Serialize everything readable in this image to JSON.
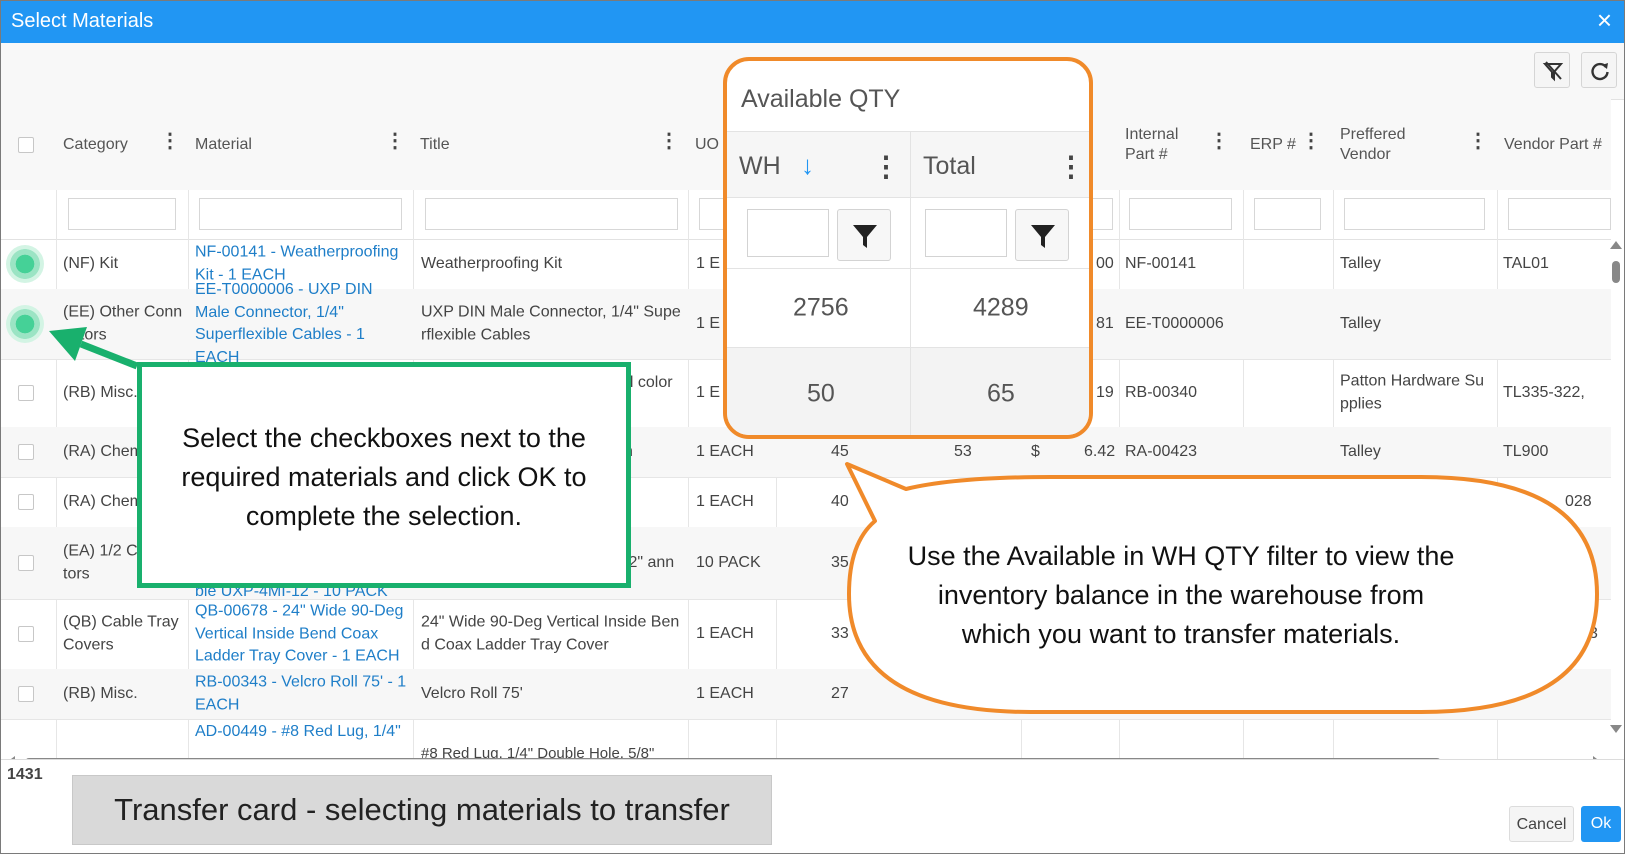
{
  "window": {
    "title": "Select Materials",
    "close_glyph": "×"
  },
  "toolbar": {
    "icons": [
      "filter-clear-icon",
      "refresh-icon"
    ]
  },
  "columns": {
    "category": "Category",
    "material": "Material",
    "title": "Title",
    "uom": "UO",
    "internal_part": "Internal Part #",
    "erp": "ERP #",
    "preferred_vendor": "Preffered Vendor",
    "vendor_part": "Vendor Part #"
  },
  "rows": [
    {
      "category": "(NF) Kit",
      "material": "NF-00141 - Weatherproofing Kit - 1 EACH",
      "title": "Weatherproofing Kit",
      "uom": "1 E",
      "cost_tail": "00",
      "internal": "NF-00141",
      "vendor": "Talley",
      "vendor_part": "TAL01"
    },
    {
      "category": "(EE) Other Connectors",
      "material": "EE-T0000006 - UXP DIN Male Connector, 1/4\" Superflexible Cables - 1 EACH",
      "title": "UXP DIN Male Connector, 1/4\" Superflexible Cables",
      "uom": "1 E",
      "cost_tail": "81",
      "internal": "EE-T0000006",
      "vendor": "Talley",
      "vendor_part": ""
    },
    {
      "category": "(RB) Misc.",
      "material": "",
      "title": "al color",
      "uom": "1 E",
      "cost_tail": "19",
      "internal": "RB-00340",
      "vendor": "Patton Hardware Supplies",
      "vendor_part": "TL335-322,"
    },
    {
      "category": "(RA) Chem",
      "material": "",
      "title": "n",
      "uom": "1 EACH",
      "wh": "45",
      "total": "53",
      "currency": "$",
      "cost": "6.42",
      "internal": "RA-00423",
      "vendor": "Talley",
      "vendor_part": "TL900"
    },
    {
      "category": "(RA) Chem",
      "material": "",
      "title": "",
      "uom": "1 EACH",
      "wh": "40",
      "total": "",
      "vendor_part": "028"
    },
    {
      "category": "(EA) 1/2 C tors",
      "material": "ble UXP-4MI-12 - 10 PACK",
      "title": "/2\" ann",
      "uom": "10 PACK",
      "wh": "35"
    },
    {
      "category": "(QB) Cable Tray Covers",
      "material": "QB-00678 - 24\" Wide 90-Deg Vertical Inside Bend Coax Ladder Tray Cover - 1 EACH",
      "title": "24\" Wide 90-Deg Vertical Inside Bend Coax Ladder Tray Cover",
      "uom": "1 EACH",
      "wh": "33",
      "vendor_part": "3"
    },
    {
      "category": "(RB) Misc.",
      "material": "RB-00343 - Velcro Roll 75' - 1 EACH",
      "title": "Velcro Roll 75'",
      "uom": "1 EACH",
      "wh": "27"
    },
    {
      "category": "",
      "material": "AD-00449 - #8 Red Lug, 1/4\"",
      "title": "#8 Red Lug, 1/4\" Double Hole, 5/8\"",
      "uom": ""
    }
  ],
  "zoom": {
    "title": "Available QTY",
    "wh_label": "WH",
    "total_label": "Total",
    "sort_glyph": "↓",
    "values": [
      {
        "wh": "2756",
        "total": "4289"
      },
      {
        "wh": "50",
        "total": "65"
      }
    ]
  },
  "footer": {
    "count": "1431",
    "cancel": "Cancel",
    "ok": "Ok"
  },
  "callouts": {
    "green": "Select the checkboxes next to the required materials and click OK to complete the selection.",
    "orange": "Use the Available in WH QTY filter to view the inventory balance in the warehouse from which you want to transfer materials."
  },
  "caption": "Transfer card - selecting materials to transfer",
  "colors": {
    "titlebar": "#2196f3",
    "link": "#1e7ec8",
    "orange": "#f08a2a",
    "green": "#19b06d",
    "ok": "#2196f3"
  }
}
